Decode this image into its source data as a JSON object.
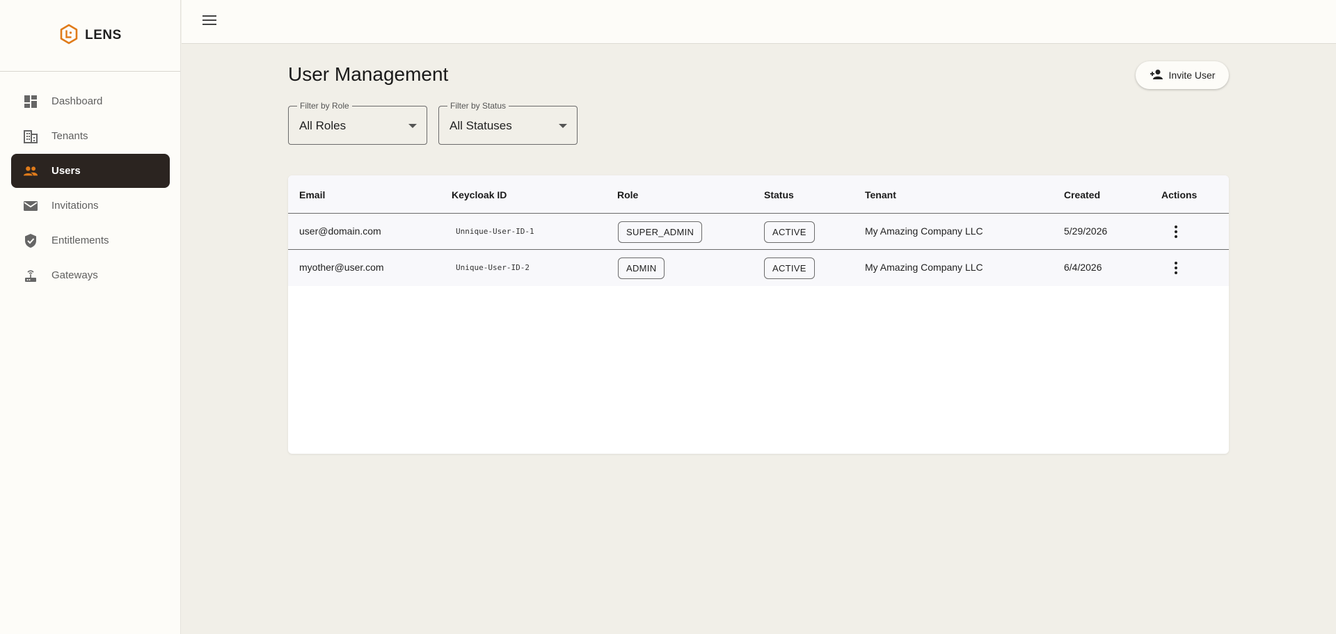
{
  "brand": {
    "name": "LENS",
    "accent": "#e07b1a"
  },
  "sidebar": {
    "items": [
      {
        "label": "Dashboard",
        "icon": "dashboard-icon",
        "active": false
      },
      {
        "label": "Tenants",
        "icon": "building-icon",
        "active": false
      },
      {
        "label": "Users",
        "icon": "people-icon",
        "active": true
      },
      {
        "label": "Invitations",
        "icon": "mail-icon",
        "active": false
      },
      {
        "label": "Entitlements",
        "icon": "shield-check-icon",
        "active": false
      },
      {
        "label": "Gateways",
        "icon": "router-icon",
        "active": false
      }
    ]
  },
  "page": {
    "title": "User Management",
    "invite_label": "Invite User"
  },
  "filters": {
    "role": {
      "label": "Filter by Role",
      "value": "All Roles"
    },
    "status": {
      "label": "Filter by Status",
      "value": "All Statuses"
    }
  },
  "table": {
    "columns": [
      "Email",
      "Keycloak ID",
      "Role",
      "Status",
      "Tenant",
      "Created",
      "Actions"
    ],
    "rows": [
      {
        "email": "user@domain.com",
        "keycloak_id": "Unnique-User-ID-1",
        "role": "SUPER_ADMIN",
        "status": "ACTIVE",
        "tenant": "My Amazing Company LLC",
        "created": "5/29/2026"
      },
      {
        "email": "myother@user.com",
        "keycloak_id": "Unique-User-ID-2",
        "role": "ADMIN",
        "status": "ACTIVE",
        "tenant": "My Amazing Company LLC",
        "created": "6/4/2026"
      }
    ]
  }
}
